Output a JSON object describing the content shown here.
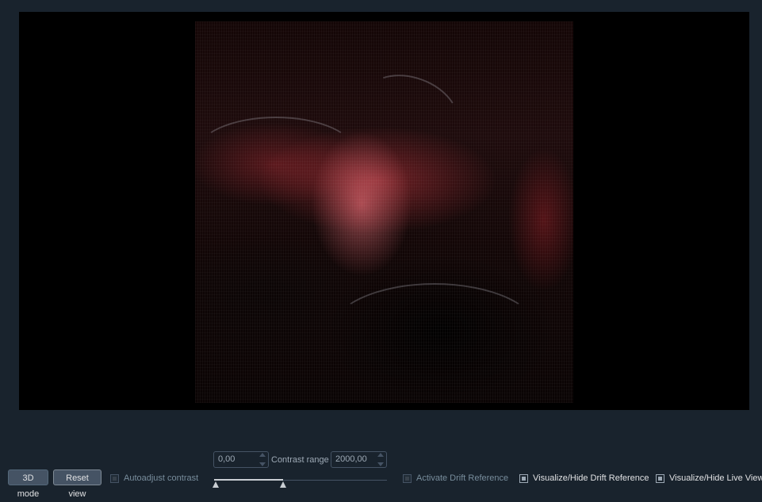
{
  "toolbar": {
    "mode_button": "3D mode",
    "reset_button": "Reset view",
    "autoadjust_label": "Autoadjust contrast",
    "contrast_min": "0,00",
    "contrast_label": "Contrast range",
    "contrast_max": "2000,00",
    "contrast_slider": {
      "min_value": 0,
      "max_value": 2000,
      "low_fraction": 0.0,
      "high_fraction": 0.4
    },
    "drift_activate_label": "Activate Drift Reference",
    "drift_visualize_label": "Visualize/Hide Drift Reference",
    "live_visualize_label": "Visualize/Hide Live View"
  },
  "colors": {
    "background": "#19232d",
    "button": "#455364",
    "viewport": "#000000",
    "image_tint": "#e04050"
  }
}
